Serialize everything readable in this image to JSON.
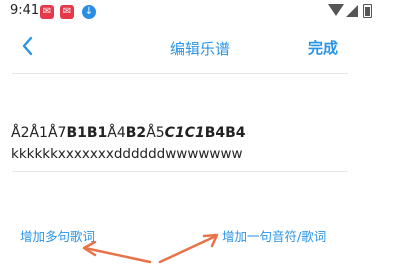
{
  "status_bar": {
    "time": "9:41",
    "icons": [
      "app-notify-icon",
      "app-notify-icon",
      "download-icon",
      "wifi-icon",
      "signal-icon",
      "battery-icon"
    ]
  },
  "header": {
    "back_icon": "chevron-left-icon",
    "title": "编辑乐谱",
    "done_label": "完成"
  },
  "score": {
    "notes_segments": [
      {
        "text": "Å2Å1Å7",
        "style": "normal"
      },
      {
        "text": "B1B1",
        "style": "bold"
      },
      {
        "text": "Å4",
        "style": "normal"
      },
      {
        "text": "B2",
        "style": "bold"
      },
      {
        "text": "Å5",
        "style": "normal"
      },
      {
        "text": "C1C1",
        "style": "bold-italic"
      },
      {
        "text": "B4B4",
        "style": "bold"
      }
    ],
    "lyrics": "kkkkkkxxxxxxxddddddwwwwwww"
  },
  "actions": {
    "add_multi_lyrics": "增加多句歌词",
    "add_note_lyric": "增加一句音符/歌词"
  },
  "colors": {
    "accent": "#2a95e8",
    "arrow": "#e8734a"
  }
}
